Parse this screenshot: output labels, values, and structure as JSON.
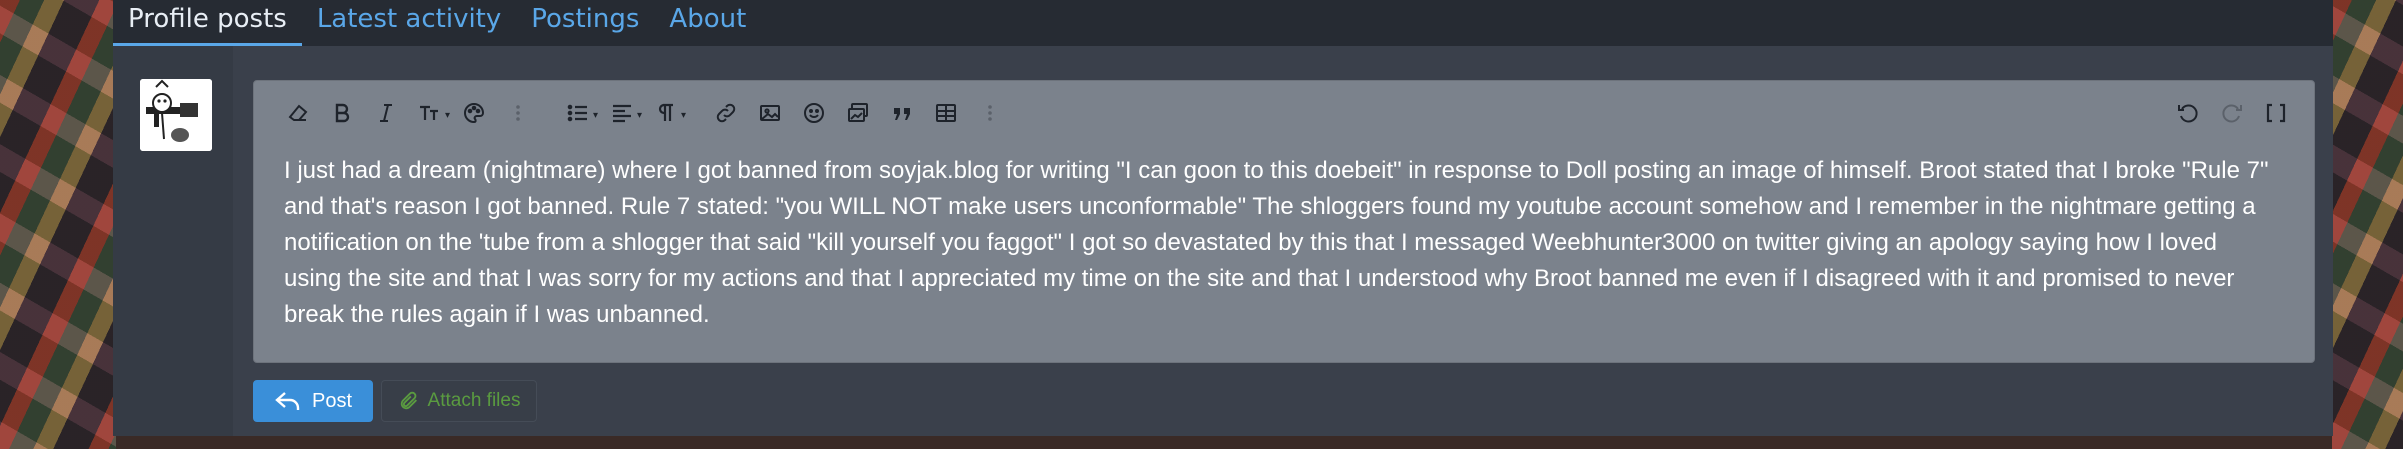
{
  "tabs": [
    {
      "label": "Profile posts",
      "active": true
    },
    {
      "label": "Latest activity",
      "active": false
    },
    {
      "label": "Postings",
      "active": false
    },
    {
      "label": "About",
      "active": false
    }
  ],
  "toolbar": {
    "left_icons": [
      "eraser-icon",
      "bold-icon",
      "italic-icon",
      "text-size-icon",
      "palette-icon",
      "more-vertical-icon",
      "bulleted-list-icon",
      "align-icon",
      "paragraph-icon",
      "link-icon",
      "image-icon",
      "smiley-icon",
      "media-icon",
      "quote-icon",
      "table-icon",
      "more-vertical-icon"
    ],
    "right_icons": [
      "undo-icon",
      "redo-icon",
      "fullscreen-icon"
    ]
  },
  "editor": {
    "text": "I just had a dream (nightmare) where I got banned from soyjak.blog for writing \"I can goon to this doebeit\" in response to Doll posting an image of himself. Broot stated that I broke \"Rule 7\" and that's reason I got banned. Rule 7 stated: \"you WILL NOT make users unconformable\" The shloggers found my youtube account somehow and I remember in the nightmare getting a notification on the 'tube from a shlogger that said \"kill yourself you faggot\" I got so devastated by this that I messaged Weebhunter3000 on twitter giving an apology saying how I loved using the site and that I was sorry for my actions and that I appreciated my time on the site and that I understood why Broot banned me even if I disagreed with it and promised to never break the rules again if I was unbanned."
  },
  "actions": {
    "post_label": "Post",
    "attach_label": "Attach files"
  },
  "colors": {
    "accent": "#5aa7e8",
    "post_button": "#3a8fd9",
    "attach_text": "#5a9b40",
    "editor_bg": "#7b828c"
  }
}
